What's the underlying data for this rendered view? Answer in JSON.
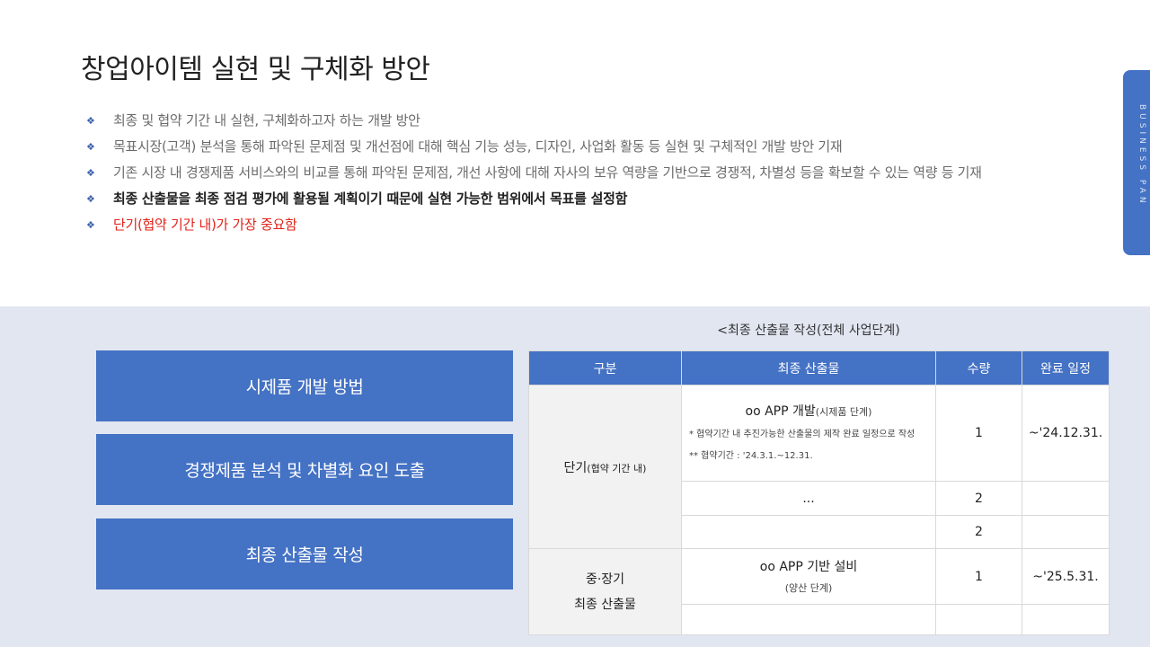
{
  "title": "창업아이템 실현 및 구체화 방안",
  "side_tab_label": "BUSINESS PAN",
  "bullets": [
    "최종 및 협약 기간 내 실현, 구체화하고자 하는 개발 방안",
    "목표시장(고객) 분석을 통해 파악된 문제점 및 개선점에 대해 핵심 기능 성능, 디자인, 사업화 활동 등 실현 및 구체적인 개발 방안 기재",
    "기존 시장 내 경쟁제품 서비스와의 비교를 통해 파악된 문제점, 개선 사항에 대해 자사의 보유 역량을 기반으로 경쟁적, 차별성 등을 확보할 수 있는 역량 등 기재",
    "최종 산출물을 최종 점검 평가에 활용될 계획이기 때문에 실현 가능한 범위에서 목표를 설정함",
    "단기(협약 기간 내)가 가장 중요함"
  ],
  "methods": [
    "시제품 개발 방법",
    "경쟁제품 분석 및 차별화 요인 도출",
    "최종 산출물 작성"
  ],
  "table": {
    "caption": "<최종 산출물 작성(전체 사업단계)",
    "headers": [
      "구분",
      "최종 산출물",
      "수량",
      "완료 일정"
    ],
    "short_term": {
      "category": "단기",
      "category_sub": "(협약 기간 내)",
      "row1": {
        "product": "oo APP 개발",
        "product_sub": "(시제품 단계)",
        "note1": "* 협약기간 내 추진가능한 산출물의 제작 완료 일정으로 작성",
        "note2": "** 협약기간 : '24.3.1.~12.31.",
        "qty": "1",
        "date": "~'24.12.31."
      },
      "row2": {
        "product": "...",
        "qty": "2",
        "date": ""
      },
      "row3": {
        "product": "",
        "qty": "2",
        "date": ""
      }
    },
    "long_term": {
      "category_line1": "중·장기",
      "category_line2": "최종 산출물",
      "row1": {
        "product": "oo APP 기반 설비",
        "product_sub": "(양산 단계)",
        "qty": "1",
        "date": "~'25.5.31."
      },
      "row2": {
        "product": "",
        "qty": "",
        "date": ""
      }
    }
  }
}
